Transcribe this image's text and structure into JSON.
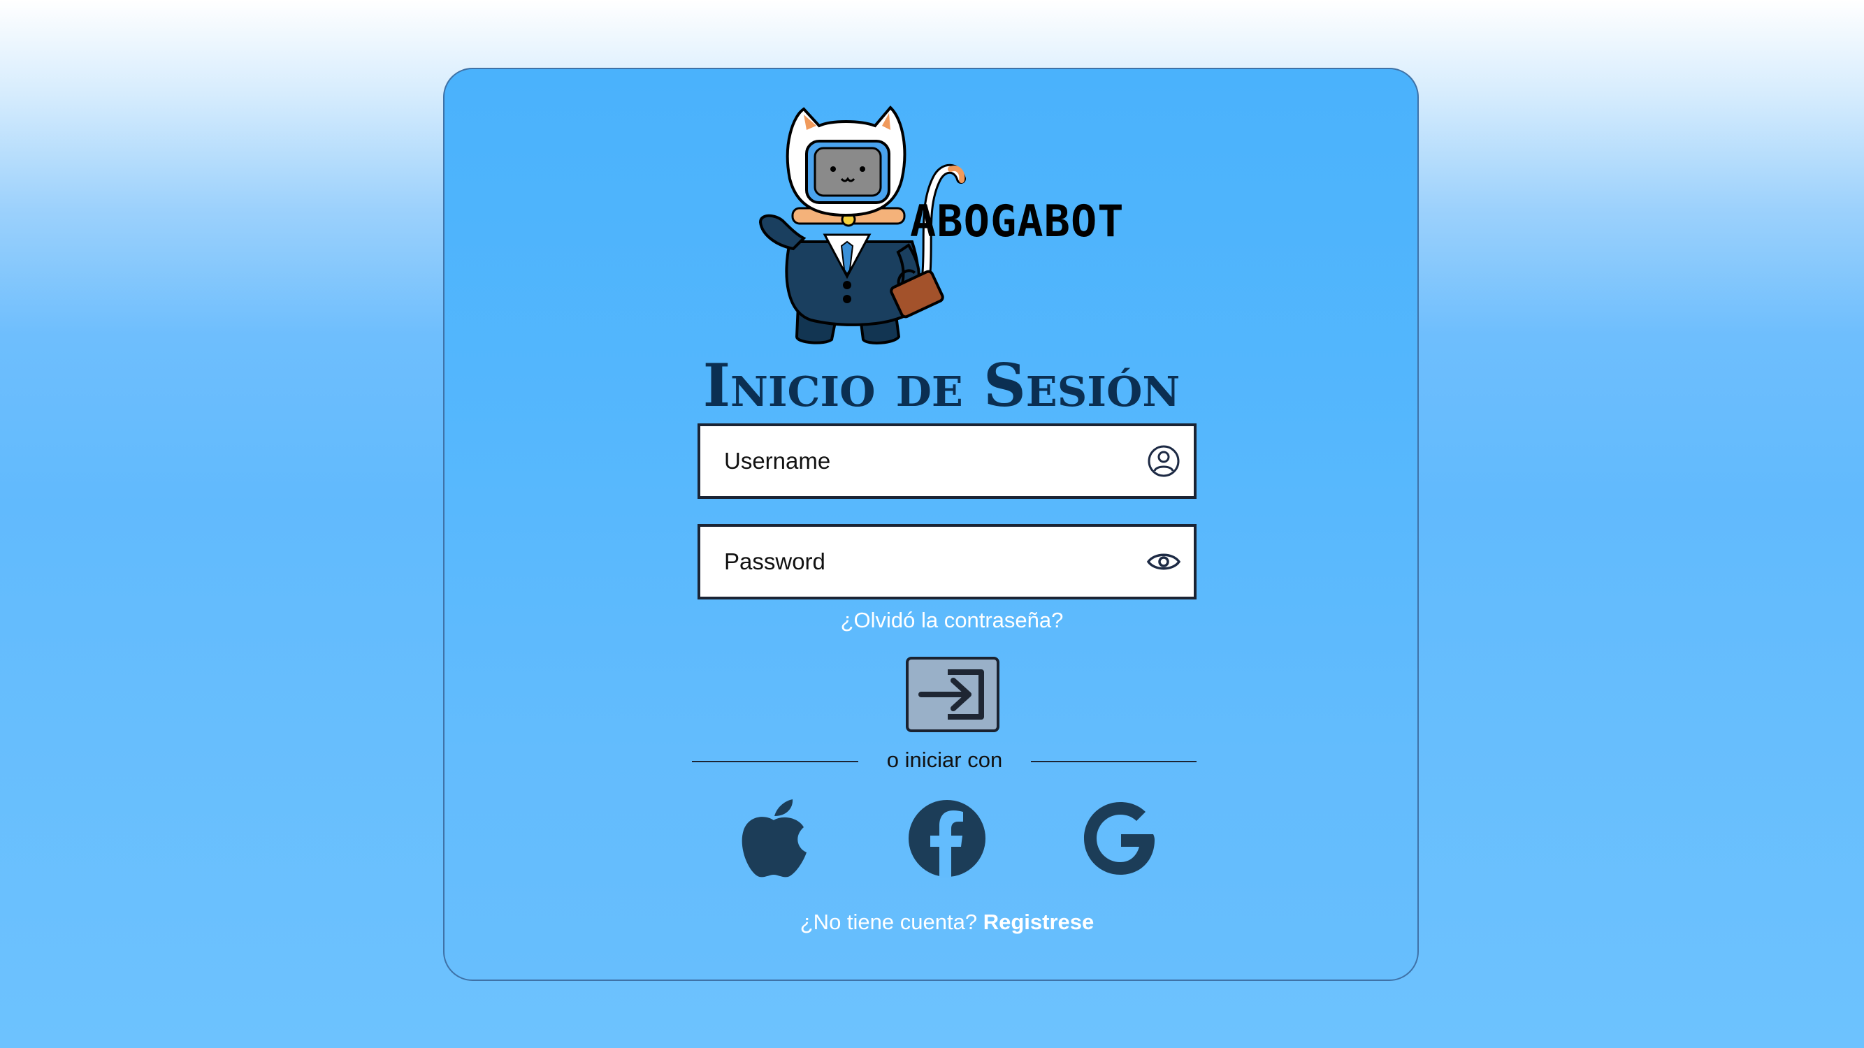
{
  "brand": {
    "name": "ABOGABOT"
  },
  "login": {
    "title": "Inicio de Sesión",
    "username_label": "Username",
    "password_label": "Password",
    "forgot_link": "¿Olvidó la contraseña?",
    "submit_icon": "login-arrow-icon",
    "divider_text": "o iniciar con",
    "signup_prompt": "¿No tiene cuenta?",
    "signup_link": "Registrese"
  },
  "social": [
    {
      "name": "Apple",
      "icon": "apple-icon"
    },
    {
      "name": "Facebook",
      "icon": "facebook-icon"
    },
    {
      "name": "Google",
      "icon": "google-icon"
    }
  ],
  "colors": {
    "card_background": "#4ab2fc",
    "title_color": "#0b2f52",
    "social_icon_color": "#1c3d58",
    "button_background": "#99b0c8"
  }
}
